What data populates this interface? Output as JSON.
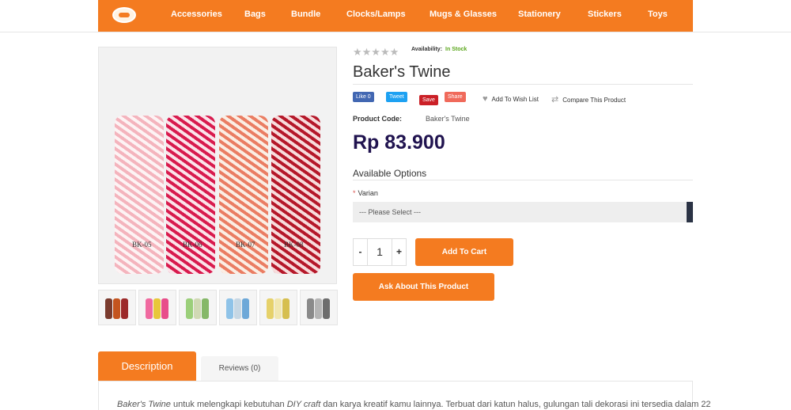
{
  "nav": {
    "items": [
      "Accessories",
      "Bags",
      "Bundle",
      "Clocks/Lamps",
      "Mugs & Glasses",
      "Stationery",
      "Stickers",
      "Toys"
    ]
  },
  "gallery": {
    "spool_labels": [
      "BK-05",
      "BK-06",
      "BK-07",
      "BK-08"
    ],
    "thumb_count": 6
  },
  "product": {
    "rating_stars": "★★★★★",
    "rating_value": 0,
    "availability_label": "Availability:",
    "availability_value": "In Stock",
    "title": "Baker's Twine",
    "share": {
      "facebook": "Like 0",
      "twitter": "Tweet",
      "pinterest": "Save",
      "google": "Share"
    },
    "wishlist_label": "Add To Wish List",
    "compare_label": "Compare This Product",
    "code_label": "Product Code:",
    "code_value": "Baker's Twine",
    "price": "Rp 83.900",
    "options_title": "Available Options",
    "varian_required": "*",
    "varian_label": "Varian",
    "select_value": "--- Please Select ---",
    "qty_minus": "-",
    "qty_value": "1",
    "qty_plus": "+",
    "add_to_cart": "Add To Cart",
    "ask": "Ask About This Product"
  },
  "tabs": {
    "description": "Description",
    "reviews": "Reviews (0)"
  },
  "description": {
    "part1": "Baker's Twine",
    "part2": " untuk melengkapi kebutuhan ",
    "part3": "DIY craft",
    "part4": " dan karya kreatif kamu lainnya. Terbuat dari katun halus, gulungan tali dekorasi ini tersedia dalam 22"
  },
  "colors": {
    "brand": "#f47b20",
    "price": "#20134f",
    "in_stock": "#5aa61b"
  }
}
